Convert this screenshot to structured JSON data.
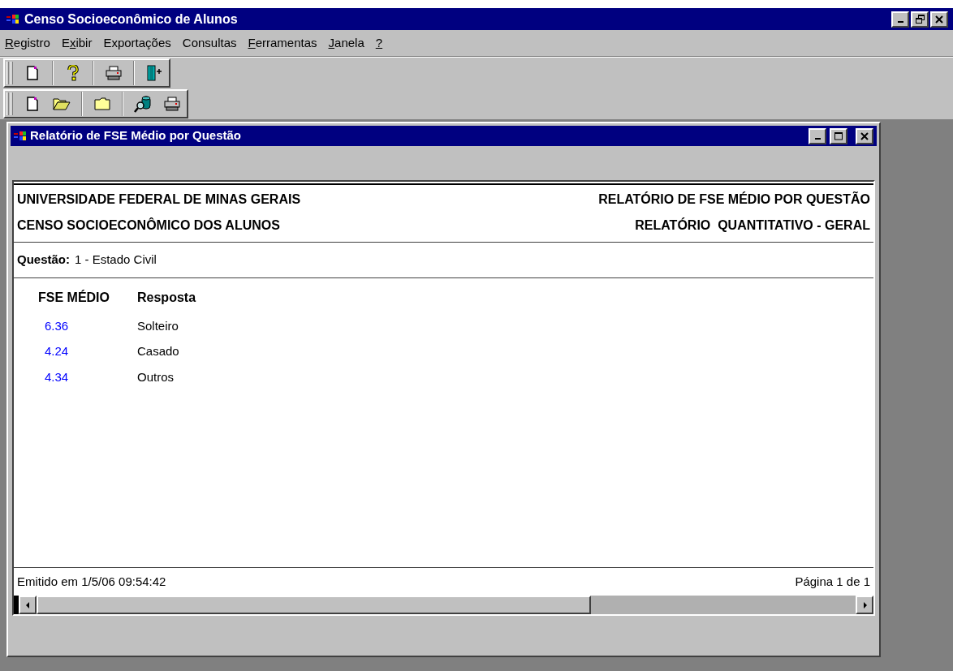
{
  "app_window": {
    "title": "Censo Socioeconômico de Alunos"
  },
  "menu": [
    {
      "key": "R",
      "post": "egistro"
    },
    {
      "pre": "E",
      "key": "x",
      "post": "ibir"
    },
    {
      "pre": "Exportações"
    },
    {
      "pre": "Consultas"
    },
    {
      "key": "F",
      "post": "erramentas"
    },
    {
      "key": "J",
      "post": "anela"
    },
    {
      "key": "?"
    }
  ],
  "toolbars": [
    [
      {
        "kind": "new"
      },
      {
        "kind": "help"
      },
      {
        "kind": "print"
      },
      {
        "kind": "exit"
      }
    ],
    [
      {
        "kind": "new"
      },
      {
        "kind": "open"
      },
      {
        "kind": "folder"
      },
      {
        "kind": "search"
      },
      {
        "kind": "print"
      }
    ]
  ],
  "report_window": {
    "title": "Relatório de FSE Médio por Questão"
  },
  "report": {
    "header_left": [
      "UNIVERSIDADE FEDERAL DE MINAS GERAIS",
      "CENSO SOCIOECONÔMICO DOS ALUNOS"
    ],
    "header_right": [
      "RELATÓRIO DE FSE MÉDIO POR QUESTÃO",
      "RELATÓRIO  QUANTITATIVO - GERAL"
    ],
    "question_label": "Questão:",
    "question_value": "1 - Estado Civil",
    "columns": [
      "FSE MÉDIO",
      "Resposta"
    ],
    "rows": [
      {
        "value": "6.36",
        "answer": "Solteiro"
      },
      {
        "value": "4.24",
        "answer": "Casado"
      },
      {
        "value": "4.34",
        "answer": "Outros"
      }
    ],
    "footer_left": "Emitido em 1/5/06 09:54:42",
    "footer_right": "Página 1 de 1"
  }
}
